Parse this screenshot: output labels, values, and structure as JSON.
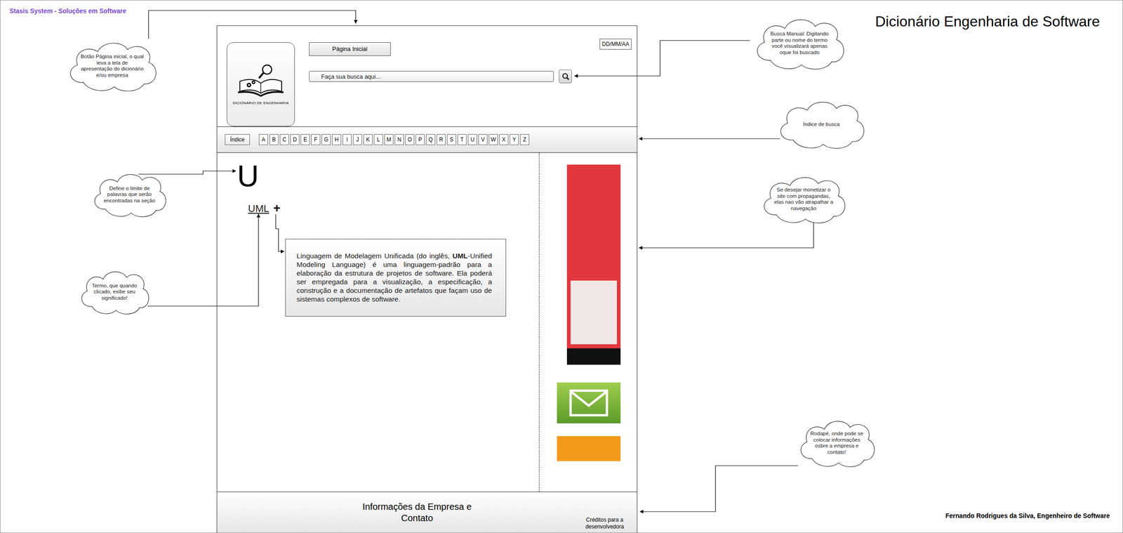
{
  "brand": "Stasis System - Soluções em Software",
  "title": "Dicionário Engenharia de Software",
  "author": "Fernando Rodrigues da Silva, Engenheiro de Software",
  "mockup": {
    "logo_text": "DICIONÁRIO DE ENGENHARIA",
    "home_button": "Página Inicial",
    "date": "DD/MM/AA",
    "search": {
      "placeholder": "Faça sua busca aqui..."
    },
    "index_button": "Índice",
    "letters": [
      "A",
      "B",
      "C",
      "D",
      "E",
      "F",
      "G",
      "H",
      "I",
      "J",
      "K",
      "L",
      "M",
      "N",
      "O",
      "P",
      "Q",
      "R",
      "S",
      "T",
      "U",
      "V",
      "W",
      "X",
      "Y",
      "Z"
    ],
    "section_letter": "U",
    "term": {
      "label": "UML",
      "toggle": "+",
      "expanded": true,
      "definition": [
        {
          "text": "Linguagem de Modelagem Unificada (do inglês, ",
          "bold": false
        },
        {
          "text": "UML",
          "bold": true
        },
        {
          "text": "-Unified Modeling Language) é uma linguagem-padrão para a elaboração da estrutura de projetos de software. Ela poderá ser empregada para a visualização, a especificação, a construção e a documentação de artefatos que façam uso de sistemas complexos de software.",
          "bold": false
        }
      ]
    },
    "footer": {
      "info": "Informações da Empresa e Contato",
      "credits": "Créditos para a desenvolvedora"
    }
  },
  "notes": [
    {
      "text": "Botão Página inicial, o qual leva a tela de apresentação do dicionário e/ou empresa"
    },
    {
      "text": "Busca Manual: Digitando parte ou nome do termo você visualizará apenas oque foi buscado"
    },
    {
      "text": "Índice de busca"
    },
    {
      "text": "Se desejar monetizar o site com propagandas, elas nao vão atrapalhar a navegação"
    },
    {
      "text": "Define o limite de palavras que serão encontradas na seção"
    },
    {
      "text": "Termo, que quando clicado, exibe seu significado!"
    },
    {
      "text": "Rodapé, onde pode se colocar informações osbre a empresa e contato!"
    }
  ]
}
